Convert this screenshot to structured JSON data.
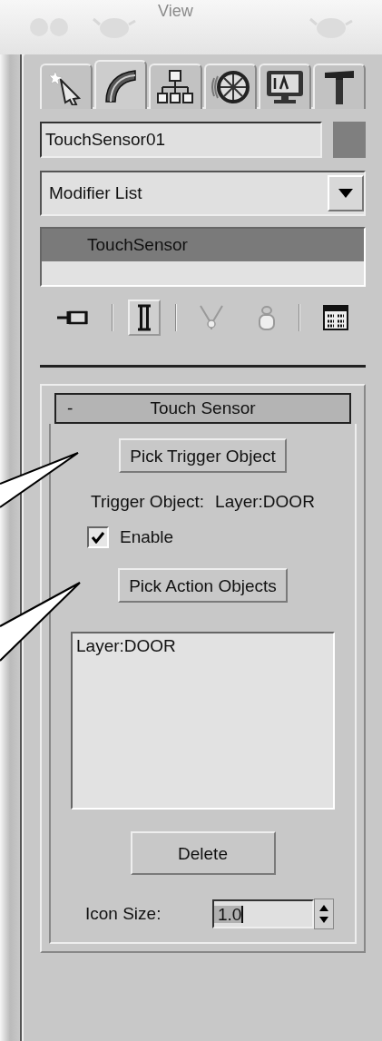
{
  "toolbar": {
    "label": "View"
  },
  "tabs": [
    {
      "kind": "create",
      "selected": false
    },
    {
      "kind": "modify",
      "selected": true
    },
    {
      "kind": "hierarchy",
      "selected": false
    },
    {
      "kind": "motion",
      "selected": false
    },
    {
      "kind": "display",
      "selected": false
    },
    {
      "kind": "utilities",
      "selected": false
    }
  ],
  "object": {
    "name": "TouchSensor01",
    "color": "#7f7f7f"
  },
  "modifier_list": {
    "value": "Modifier List"
  },
  "stack": [
    {
      "label": "TouchSensor",
      "selected": true
    }
  ],
  "stack_tools": [
    {
      "kind": "pin",
      "pressed": false,
      "disabled": false
    },
    {
      "kind": "show_end",
      "pressed": true,
      "disabled": false
    },
    {
      "kind": "unique",
      "pressed": false,
      "disabled": true
    },
    {
      "kind": "remove",
      "pressed": false,
      "disabled": true
    },
    {
      "kind": "configure",
      "pressed": false,
      "disabled": false
    }
  ],
  "rollout": {
    "collapse_sign": "-",
    "title": "Touch Sensor",
    "pick_trigger_button": "Pick Trigger Object",
    "trigger_label": "Trigger Object:",
    "trigger_value": "Layer:DOOR",
    "enable": {
      "label": "Enable",
      "checked": true
    },
    "pick_action_button": "Pick Action Objects",
    "action_objects": [
      "Layer:DOOR"
    ],
    "delete_button": "Delete",
    "icon_size": {
      "label": "Icon Size:",
      "value": "1.0"
    }
  }
}
